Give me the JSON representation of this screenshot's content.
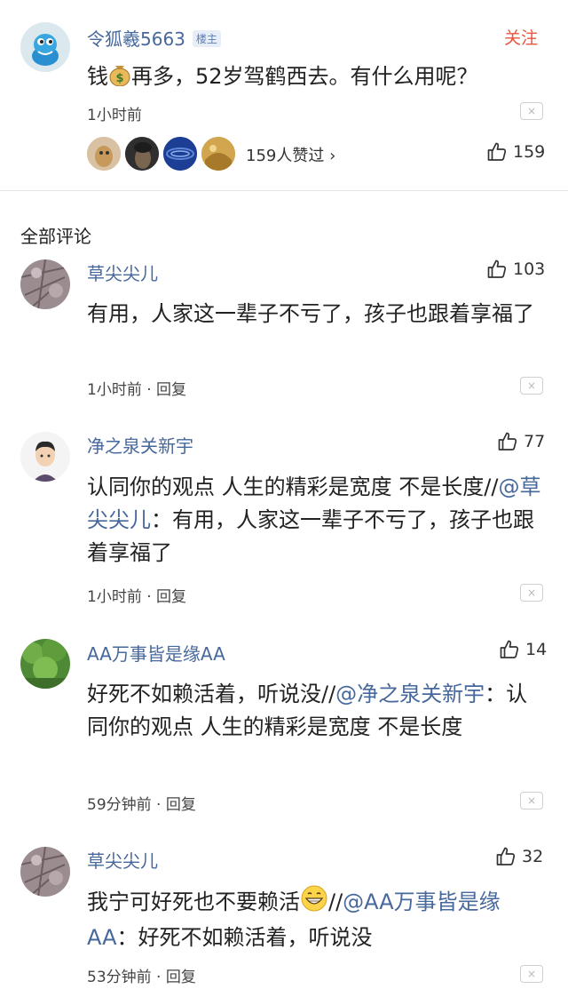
{
  "op": {
    "username": "令狐羲5663",
    "tag": "楼主",
    "follow": "关注",
    "text_before_emoji": "钱",
    "emoji": "money-bag",
    "text_after_emoji": "再多，52岁驾鹤西去。有什么用呢？",
    "time": "1小时前",
    "likers_label": "159人赞过 ›",
    "like_count": "159"
  },
  "section_title": "全部评论",
  "comments": [
    {
      "username": "草尖尖儿",
      "likes": "103",
      "text": "有用，人家这一辈子不亏了，孩子也跟着享福了",
      "meta": "1小时前 · 回复"
    },
    {
      "username": "净之泉关新宇",
      "likes": "77",
      "text": "认同你的观点 人生的精彩是宽度 不是长度//",
      "mention": "@草尖尖儿",
      "quote": "：有用，人家这一辈子不亏了，孩子也跟着享福了",
      "meta": "1小时前 · 回复"
    },
    {
      "username": "AA万事皆是缘AA",
      "likes": "14",
      "text": "好死不如赖活着，听说没//",
      "mention": "@净之泉关新宇",
      "quote": "：认同你的观点 人生的精彩是宽度 不是长度",
      "meta": "59分钟前 · 回复"
    },
    {
      "username": "草尖尖儿",
      "likes": "32",
      "text": "我宁可好死也不要赖活",
      "emoji": "grin",
      "sep": "//",
      "mention": "@AA万事皆是缘AA",
      "quote": "：好死不如赖活着，听说没",
      "meta": "53分钟前 · 回复"
    }
  ],
  "close_glyph": "×",
  "icons": {
    "like": "thumbs-up-icon",
    "close": "close-icon",
    "money": "money-bag-icon",
    "grin": "grin-emoji-icon"
  },
  "colors": {
    "username": "#47689c",
    "follow": "#e8543c",
    "text": "#222222"
  }
}
